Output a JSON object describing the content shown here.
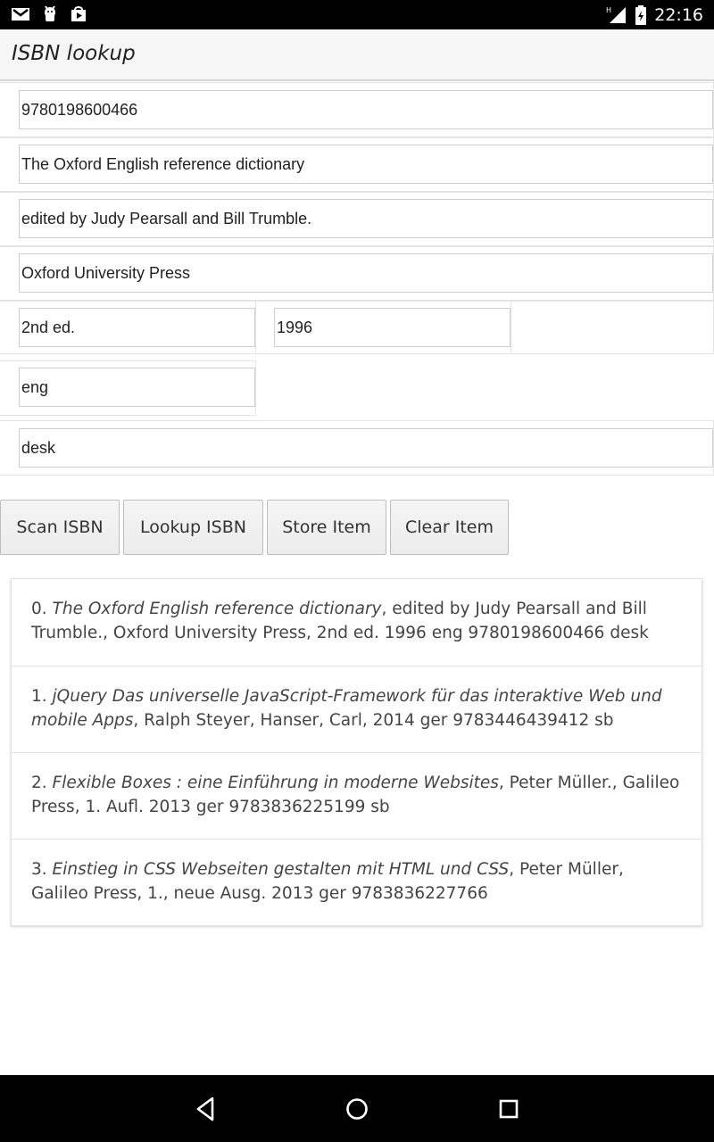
{
  "status_bar": {
    "time": "22:16",
    "icons": [
      "gmail-icon",
      "android-debug-icon",
      "play-store-icon",
      "signal-icon",
      "battery-icon"
    ]
  },
  "app_bar": {
    "title": "ISBN lookup"
  },
  "form": {
    "isbn": "9780198600466",
    "title": "The Oxford English reference dictionary",
    "author": "edited by Judy Pearsall and Bill Trumble.",
    "publisher": "Oxford University Press",
    "edition": "2nd ed.",
    "year": "1996",
    "language": "eng",
    "location": "desk"
  },
  "buttons": {
    "scan": "Scan ISBN",
    "lookup": "Lookup ISBN",
    "store": "Store Item",
    "clear": "Clear Item"
  },
  "items": [
    {
      "index": "0.",
      "title": "The Oxford English reference dictionary",
      "details": ", edited by Judy Pearsall and Bill Trumble., Oxford University Press, 2nd ed. 1996 eng 9780198600466 desk"
    },
    {
      "index": "1.",
      "title": "jQuery Das universelle JavaScript-Framework für das interaktive Web und mobile Apps",
      "details": ", Ralph Steyer, Hanser, Carl, 2014 ger 9783446439412 sb"
    },
    {
      "index": "2.",
      "title": "Flexible Boxes : eine Einführung in moderne Websites",
      "details": ", Peter Müller., Galileo Press, 1. Aufl. 2013 ger 9783836225199 sb"
    },
    {
      "index": "3.",
      "title": "Einstieg in CSS Webseiten gestalten mit HTML und CSS",
      "details": ", Peter Müller, Galileo Press, 1., neue Ausg. 2013 ger 9783836227766"
    }
  ],
  "nav_bar": {
    "icons": [
      "back-icon",
      "home-icon",
      "recents-icon"
    ]
  },
  "colors": {
    "status_bar": "#000000",
    "app_bar": "#f6f6f6",
    "nav_bar": "#000000"
  }
}
